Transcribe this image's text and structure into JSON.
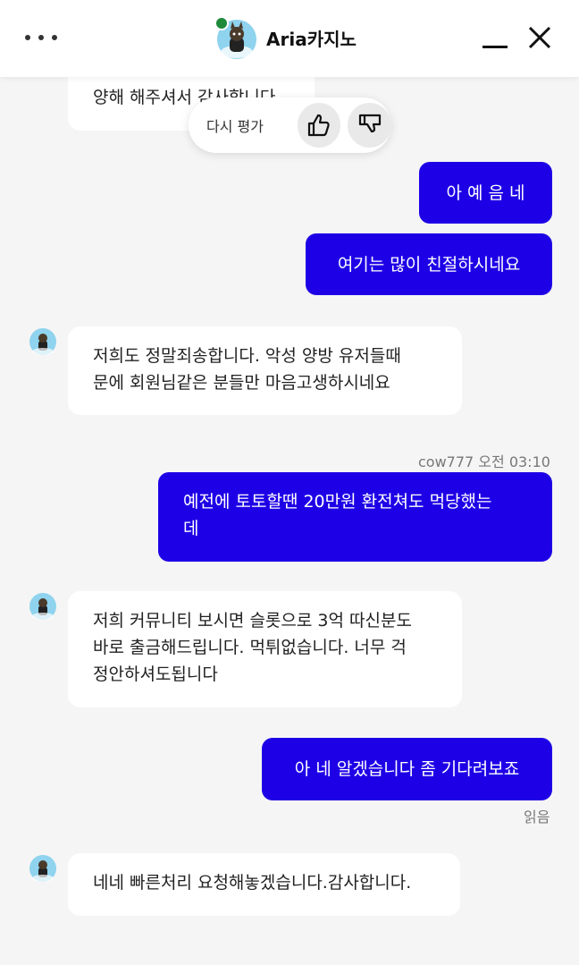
{
  "header": {
    "title": "Aria카지노",
    "menu_icon": "more-dots-icon",
    "minimize_icon": "minimize-icon",
    "close_icon": "close-icon"
  },
  "rating": {
    "label": "다시 평가",
    "thumbs_up_icon": "thumbs-up-icon",
    "thumbs_down_icon": "thumbs-down-icon"
  },
  "messages": {
    "m0": {
      "lines": [
        "양해 해주셔서 감사합니다"
      ]
    },
    "m1": {
      "text": "아 예 음 네"
    },
    "m2": {
      "text": "여기는 많이 친절하시네요"
    },
    "m3": {
      "lines": [
        "저희도 정말죄송합니다. 악성 양방 유저들때",
        "문에 회원님같은 분들만 마음고생하시네요"
      ]
    },
    "m4": {
      "meta": "cow777 오전 03:10",
      "lines": [
        "예전에 토토할땐 20만원 환전쳐도 먹당했는",
        "데"
      ]
    },
    "m5": {
      "lines": [
        "저희 커뮤니티 보시면 슬롯으로 3억 따신분도",
        "바로 출금해드립니다. 먹튀없습니다. 너무 걱",
        "정안하셔도됩니다"
      ]
    },
    "m6": {
      "text": "아 네 알겠습니다 좀 기다려보죠",
      "read_label": "읽음"
    },
    "m7": {
      "lines": [
        "네네 빠른처리 요청해놓겠습니다.감사합니다."
      ]
    }
  },
  "colors": {
    "outgoing_bubble": "#1e00e6",
    "incoming_bubble": "#ffffff",
    "background": "#f5f5f5",
    "online_dot": "#1e8a3a"
  }
}
